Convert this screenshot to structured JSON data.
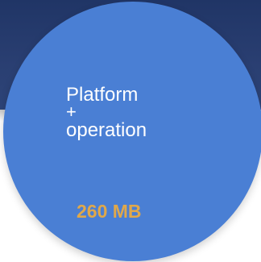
{
  "node": {
    "label_lines": [
      "Platform",
      "+",
      "operation"
    ],
    "size_value": "260 MB"
  },
  "colors": {
    "band": "#203566",
    "circle": "#4a7fd4",
    "label_text": "#ffffff",
    "size_text": "#e0a84a"
  }
}
